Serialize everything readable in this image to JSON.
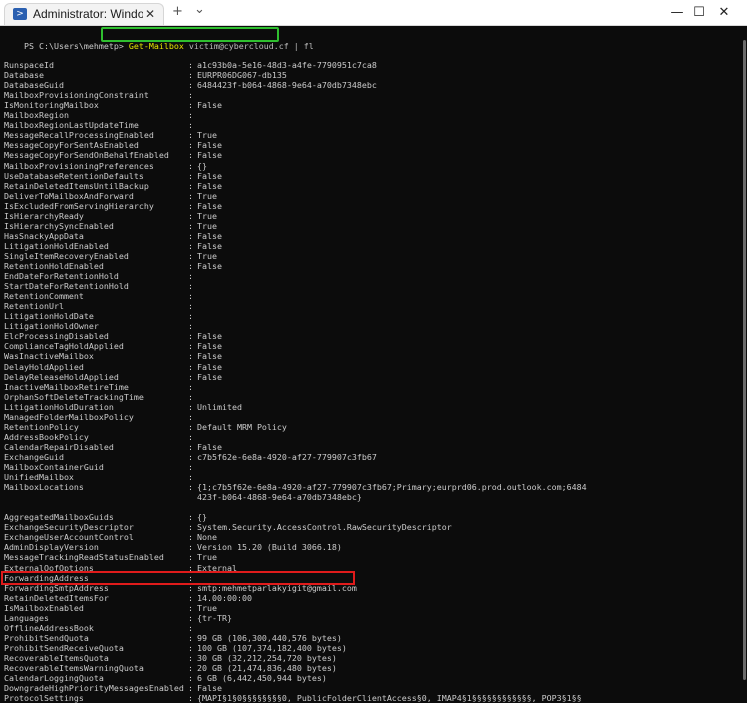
{
  "window": {
    "tab_title": "Administrator: Windows PowerS",
    "tab_icon": ">",
    "new_tab": "+",
    "dropdown": "⌄",
    "minimize": "—",
    "maximize": "☐",
    "close": "✕",
    "tab_close": "✕"
  },
  "prompt": {
    "path": "PS C:\\Users\\mehmetp>",
    "cmdlet": "Get-Mailbox",
    "args": "victim@cybercloud.cf | fl"
  },
  "highlight_colors": {
    "command": "#2fbf2f",
    "forwarding": "#e01b1b"
  },
  "properties": [
    {
      "key": "RunspaceId",
      "value": "a1c93b0a-5e16-48d3-a4fe-7790951c7ca8"
    },
    {
      "key": "Database",
      "value": "EURPR06DG067-db135"
    },
    {
      "key": "DatabaseGuid",
      "value": "6484423f-b064-4868-9e64-a70db7348ebc"
    },
    {
      "key": "MailboxProvisioningConstraint",
      "value": ""
    },
    {
      "key": "IsMonitoringMailbox",
      "value": "False"
    },
    {
      "key": "MailboxRegion",
      "value": ""
    },
    {
      "key": "MailboxRegionLastUpdateTime",
      "value": ""
    },
    {
      "key": "MessageRecallProcessingEnabled",
      "value": "True"
    },
    {
      "key": "MessageCopyForSentAsEnabled",
      "value": "False"
    },
    {
      "key": "MessageCopyForSendOnBehalfEnabled",
      "value": "False"
    },
    {
      "key": "MailboxProvisioningPreferences",
      "value": "{}"
    },
    {
      "key": "UseDatabaseRetentionDefaults",
      "value": "False"
    },
    {
      "key": "RetainDeletedItemsUntilBackup",
      "value": "False"
    },
    {
      "key": "DeliverToMailboxAndForward",
      "value": "True"
    },
    {
      "key": "IsExcludedFromServingHierarchy",
      "value": "False"
    },
    {
      "key": "IsHierarchyReady",
      "value": "True"
    },
    {
      "key": "IsHierarchySyncEnabled",
      "value": "True"
    },
    {
      "key": "HasSnackyAppData",
      "value": "False"
    },
    {
      "key": "LitigationHoldEnabled",
      "value": "False"
    },
    {
      "key": "SingleItemRecoveryEnabled",
      "value": "True"
    },
    {
      "key": "RetentionHoldEnabled",
      "value": "False"
    },
    {
      "key": "EndDateForRetentionHold",
      "value": ""
    },
    {
      "key": "StartDateForRetentionHold",
      "value": ""
    },
    {
      "key": "RetentionComment",
      "value": ""
    },
    {
      "key": "RetentionUrl",
      "value": ""
    },
    {
      "key": "LitigationHoldDate",
      "value": ""
    },
    {
      "key": "LitigationHoldOwner",
      "value": ""
    },
    {
      "key": "ElcProcessingDisabled",
      "value": "False"
    },
    {
      "key": "ComplianceTagHoldApplied",
      "value": "False"
    },
    {
      "key": "WasInactiveMailbox",
      "value": "False"
    },
    {
      "key": "DelayHoldApplied",
      "value": "False"
    },
    {
      "key": "DelayReleaseHoldApplied",
      "value": "False"
    },
    {
      "key": "InactiveMailboxRetireTime",
      "value": ""
    },
    {
      "key": "OrphanSoftDeleteTrackingTime",
      "value": ""
    },
    {
      "key": "LitigationHoldDuration",
      "value": "Unlimited"
    },
    {
      "key": "ManagedFolderMailboxPolicy",
      "value": ""
    },
    {
      "key": "RetentionPolicy",
      "value": "Default MRM Policy"
    },
    {
      "key": "AddressBookPolicy",
      "value": ""
    },
    {
      "key": "CalendarRepairDisabled",
      "value": "False"
    },
    {
      "key": "ExchangeGuid",
      "value": "c7b5f62e-6e8a-4920-af27-779907c3fb67"
    },
    {
      "key": "MailboxContainerGuid",
      "value": ""
    },
    {
      "key": "UnifiedMailbox",
      "value": ""
    },
    {
      "key": "MailboxLocations",
      "value": "{1;c7b5f62e-6e8a-4920-af27-779907c3fb67;Primary;eurprd06.prod.outlook.com;6484",
      "value2": "423f-b064-4868-9e64-a70db7348ebc}"
    },
    {
      "key": "AggregatedMailboxGuids",
      "value": "{}"
    },
    {
      "key": "ExchangeSecurityDescriptor",
      "value": "System.Security.AccessControl.RawSecurityDescriptor"
    },
    {
      "key": "ExchangeUserAccountControl",
      "value": "None"
    },
    {
      "key": "AdminDisplayVersion",
      "value": "Version 15.20 (Build 3066.18)"
    },
    {
      "key": "MessageTrackingReadStatusEnabled",
      "value": "True"
    },
    {
      "key": "ExternalOofOptions",
      "value": "External"
    },
    {
      "key": "ForwardingAddress",
      "value": ""
    },
    {
      "key": "ForwardingSmtpAddress",
      "value": "smtp:mehmetparlakyigit@gmail.com"
    },
    {
      "key": "RetainDeletedItemsFor",
      "value": "14.00:00:00"
    },
    {
      "key": "IsMailboxEnabled",
      "value": "True"
    },
    {
      "key": "Languages",
      "value": "{tr-TR}"
    },
    {
      "key": "OfflineAddressBook",
      "value": ""
    },
    {
      "key": "ProhibitSendQuota",
      "value": "99 GB (106,300,440,576 bytes)"
    },
    {
      "key": "ProhibitSendReceiveQuota",
      "value": "100 GB (107,374,182,400 bytes)"
    },
    {
      "key": "RecoverableItemsQuota",
      "value": "30 GB (32,212,254,720 bytes)"
    },
    {
      "key": "RecoverableItemsWarningQuota",
      "value": "20 GB (21,474,836,480 bytes)"
    },
    {
      "key": "CalendarLoggingQuota",
      "value": "6 GB (6,442,450,944 bytes)"
    },
    {
      "key": "DowngradeHighPriorityMessagesEnabled",
      "value": "False"
    },
    {
      "key": "ProtocolSettings",
      "value": "{MAPI§1§0§§§§§§§§0, PublicFolderClientAccess§0, IMAP4§1§§§§§§§§§§§§, POP3§1§§"
    }
  ]
}
